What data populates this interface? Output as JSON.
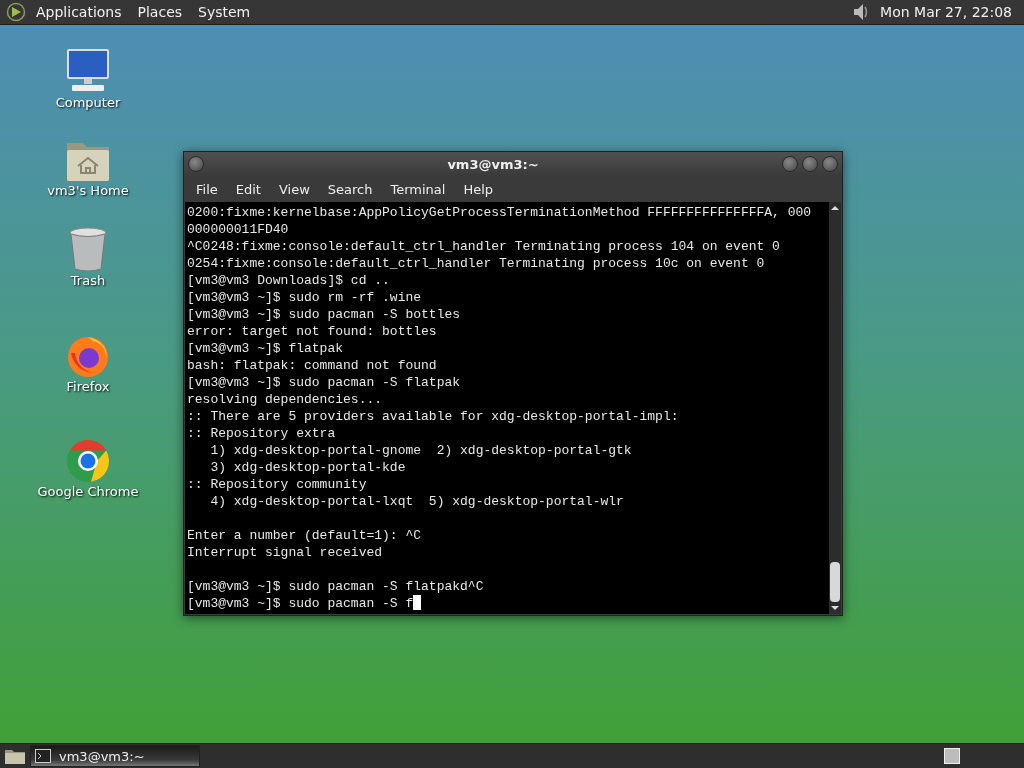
{
  "top_panel": {
    "menus": [
      "Applications",
      "Places",
      "System"
    ],
    "clock": "Mon Mar 27, 22:08"
  },
  "desktop_icons": [
    {
      "kind": "computer",
      "label": "Computer"
    },
    {
      "kind": "home",
      "label": "vm3's Home"
    },
    {
      "kind": "trash",
      "label": "Trash"
    },
    {
      "kind": "firefox",
      "label": "Firefox"
    },
    {
      "kind": "chrome",
      "label": "Google Chrome"
    }
  ],
  "terminal": {
    "title": "vm3@vm3:~",
    "menus": [
      "File",
      "Edit",
      "View",
      "Search",
      "Terminal",
      "Help"
    ],
    "lines": [
      {
        "kind": "text",
        "text": "0200:fixme:kernelbase:AppPolicyGetProcessTerminationMethod FFFFFFFFFFFFFFFA, 000"
      },
      {
        "kind": "text",
        "text": "000000011FD40"
      },
      {
        "kind": "text",
        "text": "^C0248:fixme:console:default_ctrl_handler Terminating process 104 on event 0"
      },
      {
        "kind": "text",
        "text": "0254:fixme:console:default_ctrl_handler Terminating process 10c on event 0"
      },
      {
        "kind": "text",
        "text": "[vm3@vm3 Downloads]$ cd .."
      },
      {
        "kind": "text",
        "text": "[vm3@vm3 ~]$ sudo rm -rf .wine"
      },
      {
        "kind": "text",
        "text": "[vm3@vm3 ~]$ sudo pacman -S bottles"
      },
      {
        "kind": "text",
        "text": "error: target not found: bottles"
      },
      {
        "kind": "text",
        "text": "[vm3@vm3 ~]$ flatpak"
      },
      {
        "kind": "text",
        "text": "bash: flatpak: command not found"
      },
      {
        "kind": "text",
        "text": "[vm3@vm3 ~]$ sudo pacman -S flatpak"
      },
      {
        "kind": "text",
        "text": "resolving dependencies..."
      },
      {
        "kind": "text",
        "text": ":: There are 5 providers available for xdg-desktop-portal-impl:"
      },
      {
        "kind": "text",
        "text": ":: Repository extra"
      },
      {
        "kind": "text",
        "text": "   1) xdg-desktop-portal-gnome  2) xdg-desktop-portal-gtk"
      },
      {
        "kind": "text",
        "text": "   3) xdg-desktop-portal-kde"
      },
      {
        "kind": "text",
        "text": ":: Repository community"
      },
      {
        "kind": "text",
        "text": "   4) xdg-desktop-portal-lxqt  5) xdg-desktop-portal-wlr"
      },
      {
        "kind": "blank"
      },
      {
        "kind": "text",
        "text": "Enter a number (default=1): ^C"
      },
      {
        "kind": "text",
        "text": "Interrupt signal received"
      },
      {
        "kind": "blank"
      },
      {
        "kind": "text",
        "text": "[vm3@vm3 ~]$ sudo pacman -S flatpakd^C"
      },
      {
        "kind": "text",
        "text": "[vm3@vm3 ~]$ sudo pacman -S f",
        "cursor": true
      }
    ]
  },
  "taskbar": {
    "tasks": [
      {
        "label": "vm3@vm3:~",
        "selected": true
      }
    ]
  }
}
